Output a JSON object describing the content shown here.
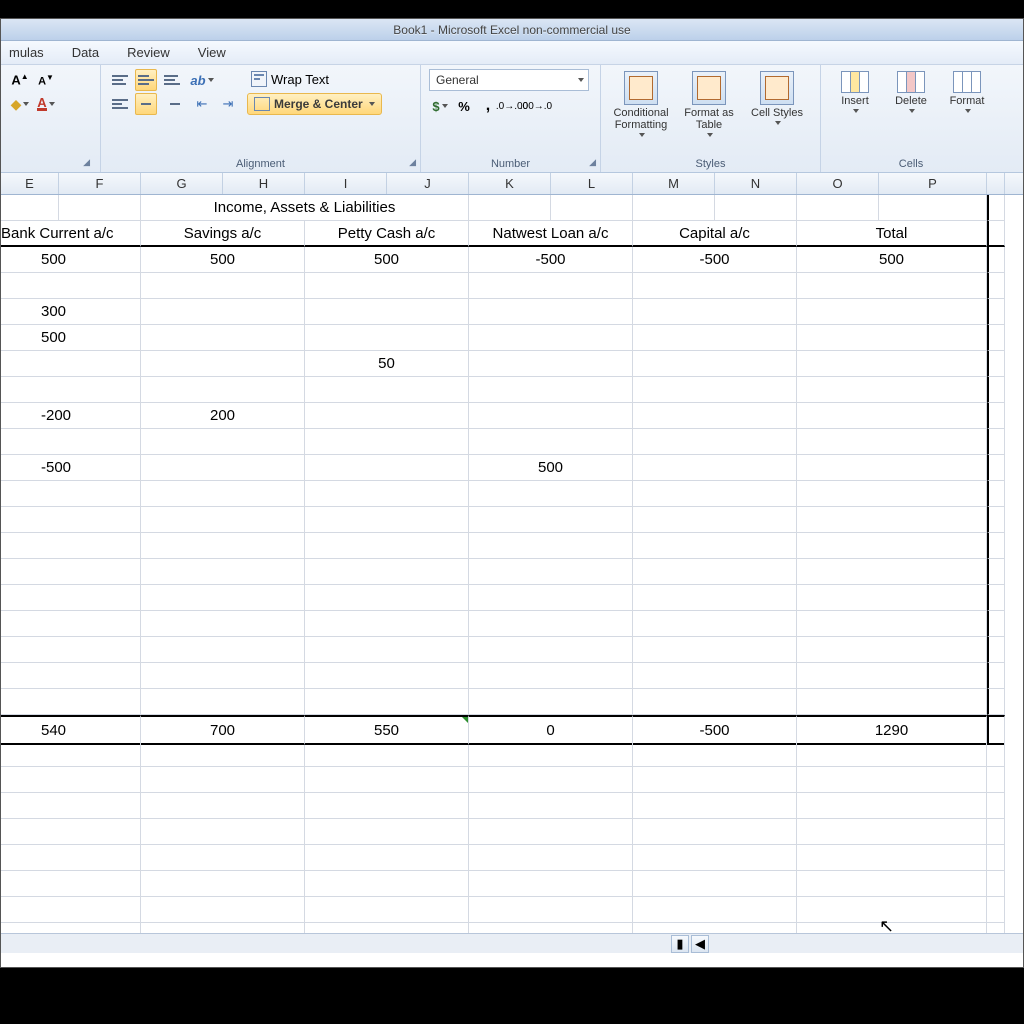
{
  "title": "Book1 - Microsoft Excel non-commercial use",
  "menu": {
    "formulas": "mulas",
    "data": "Data",
    "review": "Review",
    "view": "View"
  },
  "ribbon": {
    "wrap": "Wrap Text",
    "merge": "Merge & Center",
    "alignment_label": "Alignment",
    "number_format": "General",
    "percent": "%",
    "comma": ",",
    "number_label": "Number",
    "cond_fmt": "Conditional Formatting",
    "fmt_table": "Format as Table",
    "cell_styles": "Cell Styles",
    "styles_label": "Styles",
    "insert": "Insert",
    "delete": "Delete",
    "format": "Format",
    "cells_label": "Cells"
  },
  "cols": [
    "E",
    "F",
    "G",
    "H",
    "I",
    "J",
    "K",
    "L",
    "M",
    "N",
    "O",
    "P"
  ],
  "sheet": {
    "section_title": "Income, Assets & Liabilities",
    "headers": {
      "bank": "Bank Current a/c",
      "savings": "Savings a/c",
      "petty": "Petty Cash a/c",
      "natwest": "Natwest Loan a/c",
      "capital": "Capital a/c",
      "total": "Total"
    },
    "rows": [
      {
        "bank": "500",
        "savings": "500",
        "petty": "500",
        "natwest": "-500",
        "capital": "-500",
        "total": "500"
      },
      {
        "bank": "",
        "savings": "",
        "petty": "",
        "natwest": "",
        "capital": "",
        "total": ""
      },
      {
        "bank": "300",
        "savings": "",
        "petty": "",
        "natwest": "",
        "capital": "",
        "total": ""
      },
      {
        "bank": "500",
        "savings": "",
        "petty": "",
        "natwest": "",
        "capital": "",
        "total": ""
      },
      {
        "bank": "",
        "savings": "",
        "petty": "50",
        "natwest": "",
        "capital": "",
        "total": ""
      },
      {
        "bank": "",
        "savings": "",
        "petty": "",
        "natwest": "",
        "capital": "",
        "total": ""
      },
      {
        "bank": "-200",
        "savings": "200",
        "petty": "",
        "natwest": "",
        "capital": "",
        "total": ""
      },
      {
        "bank": "",
        "savings": "",
        "petty": "",
        "natwest": "",
        "capital": "",
        "total": ""
      },
      {
        "bank": "-500",
        "savings": "",
        "petty": "",
        "natwest": "500",
        "capital": "",
        "total": ""
      }
    ],
    "totals": {
      "bank": "540",
      "savings": "700",
      "petty": "550",
      "natwest": "0",
      "capital": "-500",
      "total": "1290"
    }
  }
}
